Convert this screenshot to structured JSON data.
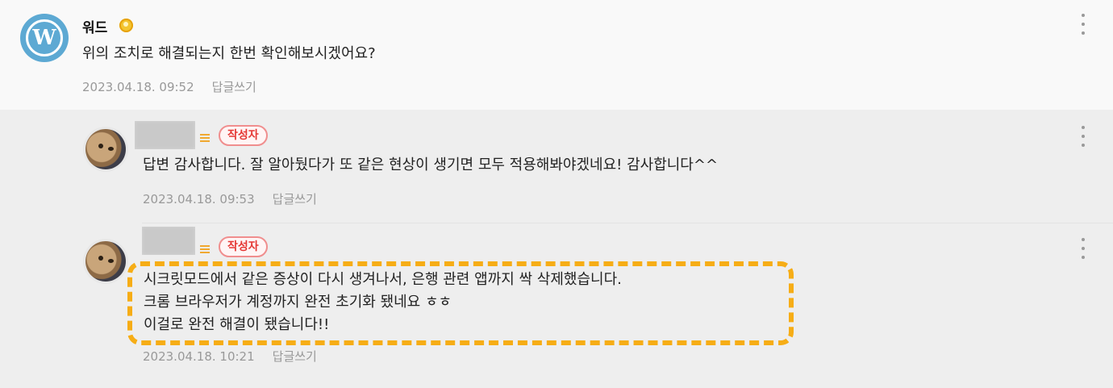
{
  "comments": [
    {
      "nickname": "워드",
      "text": "위의 조치로 해결되는지 한번 확인해보시겠어요?",
      "date": "2023.04.18. 09:52",
      "reply_label": "답글쓰기"
    },
    {
      "badge": "작성자",
      "text": "답변 감사합니다. 잘 알아뒀다가 또 같은 현상이 생기면 모두 적용해봐야겠네요! 감사합니다^^",
      "date": "2023.04.18. 09:53",
      "reply_label": "답글쓰기"
    },
    {
      "badge": "작성자",
      "lines": [
        "시크릿모드에서 같은 증상이 다시 생겨나서, 은행 관련 앱까지 싹 삭제했습니다.",
        "크롬 브라우저가 계정까지 완전 초기화 됐네요 ㅎㅎ",
        "이걸로 완전 해결이 됐습니다!!"
      ],
      "date": "2023.04.18. 10:21",
      "reply_label": "답글쓰기"
    }
  ],
  "icons": {
    "wordpress_logo": "wordpress-logo-icon",
    "grade": "grade-coin-icon",
    "level": "level-icon",
    "more": "more-vertical-icon"
  },
  "colors": {
    "highlight": "#f6ad16",
    "badge_text": "#e53935",
    "badge_border": "#f08e8e",
    "meta_text": "#999999"
  }
}
